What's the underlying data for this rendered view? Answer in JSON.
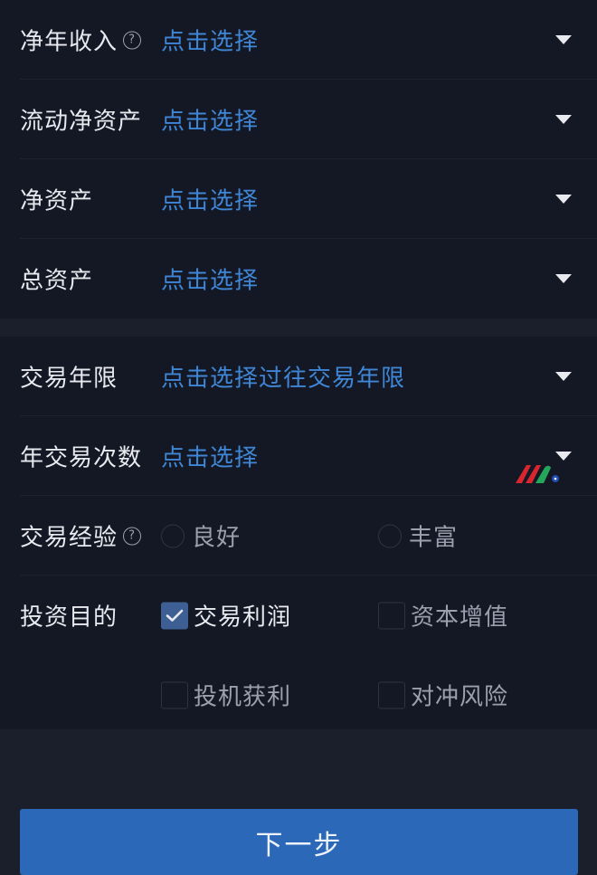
{
  "financial": {
    "rows": [
      {
        "label": "净年收入",
        "value": "点击选择",
        "has_help": true
      },
      {
        "label": "流动净资产",
        "value": "点击选择",
        "has_help": false
      },
      {
        "label": "净资产",
        "value": "点击选择",
        "has_help": false
      },
      {
        "label": "总资产",
        "value": "点击选择",
        "has_help": false
      }
    ]
  },
  "trading": {
    "years": {
      "label": "交易年限",
      "value": "点击选择过往交易年限"
    },
    "frequency": {
      "label": "年交易次数",
      "value": "点击选择"
    },
    "experience": {
      "label": "交易经验",
      "options": [
        "良好",
        "丰富"
      ],
      "selected": null
    },
    "purpose": {
      "label": "投资目的",
      "options": [
        {
          "label": "交易利润",
          "checked": true
        },
        {
          "label": "资本增值",
          "checked": false
        },
        {
          "label": "投机获利",
          "checked": false
        },
        {
          "label": "对冲风险",
          "checked": false
        }
      ]
    }
  },
  "next_button": {
    "label": "下一步"
  },
  "colors": {
    "background": "#161a26",
    "link_blue": "#3f86d6",
    "button_blue": "#2b68b7",
    "checkbox_checked": "#3e5f94"
  }
}
